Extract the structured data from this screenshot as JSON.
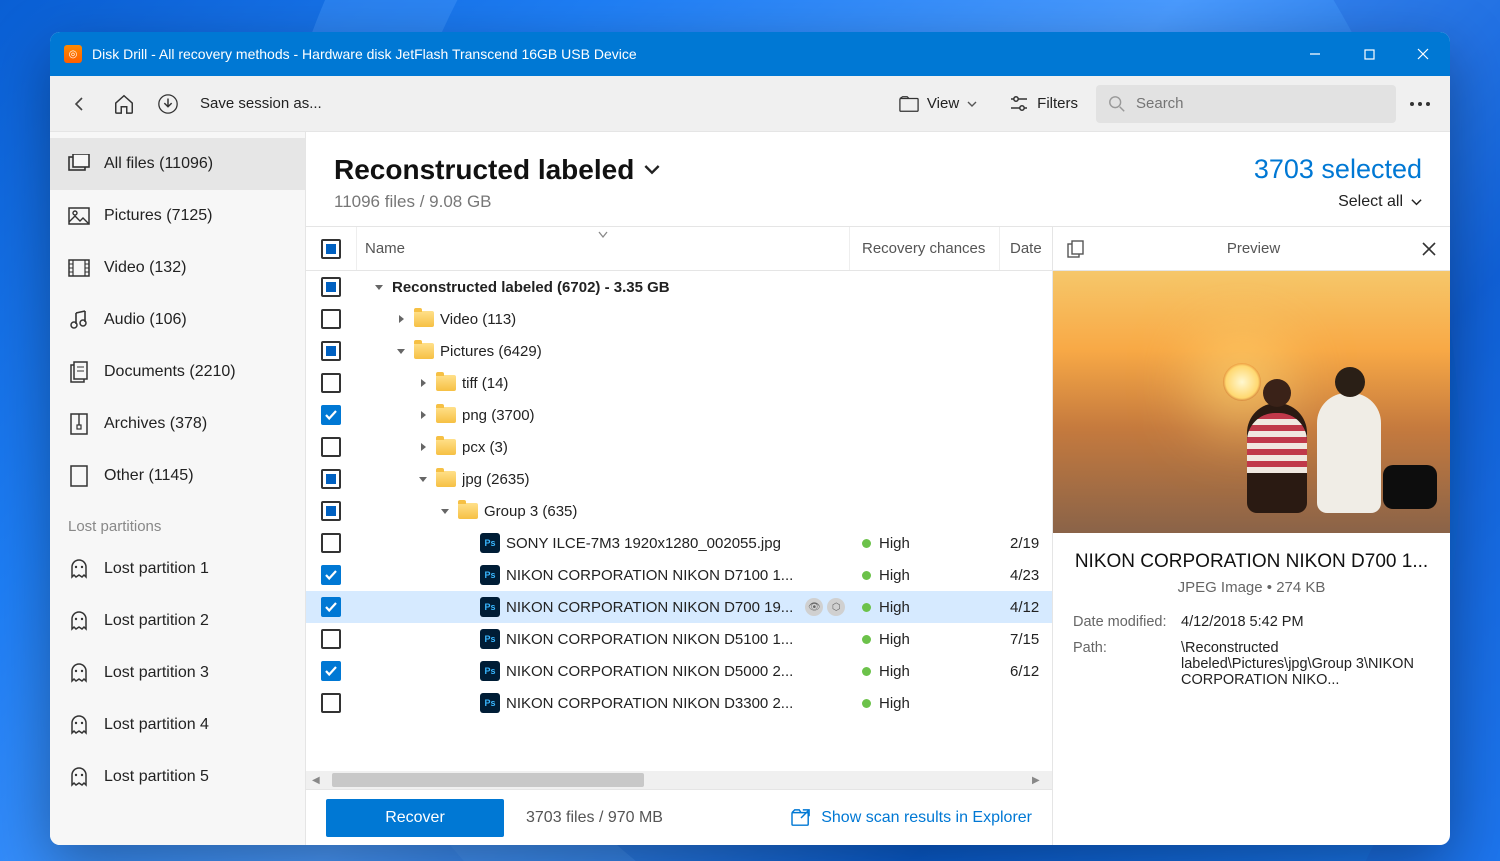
{
  "window": {
    "title": "Disk Drill - All recovery methods - Hardware disk JetFlash Transcend 16GB USB Device"
  },
  "toolbar": {
    "save_session": "Save session as...",
    "view_label": "View",
    "filters_label": "Filters",
    "search_placeholder": "Search"
  },
  "sidebar": {
    "items": [
      {
        "label": "All files (11096)"
      },
      {
        "label": "Pictures (7125)"
      },
      {
        "label": "Video (132)"
      },
      {
        "label": "Audio (106)"
      },
      {
        "label": "Documents (2210)"
      },
      {
        "label": "Archives (378)"
      },
      {
        "label": "Other (1145)"
      }
    ],
    "lost_header": "Lost partitions",
    "lost": [
      {
        "label": "Lost partition 1"
      },
      {
        "label": "Lost partition 2"
      },
      {
        "label": "Lost partition 3"
      },
      {
        "label": "Lost partition 4"
      },
      {
        "label": "Lost partition 5"
      }
    ]
  },
  "main": {
    "title": "Reconstructed labeled",
    "subtitle": "11096 files / 9.08 GB",
    "selected": "3703 selected",
    "select_all": "Select all"
  },
  "columns": {
    "name": "Name",
    "recovery": "Recovery chances",
    "date": "Date"
  },
  "rows": [
    {
      "chk": "square",
      "indent": 0,
      "expander": "down",
      "icon": "none",
      "name": "Reconstructed labeled (6702) - 3.35 GB",
      "bold": true
    },
    {
      "chk": "empty",
      "indent": 1,
      "expander": "right",
      "icon": "folder",
      "name": "Video (113)"
    },
    {
      "chk": "square",
      "indent": 1,
      "expander": "down",
      "icon": "folder",
      "name": "Pictures (6429)"
    },
    {
      "chk": "empty",
      "indent": 2,
      "expander": "right",
      "icon": "folder",
      "name": "tiff (14)"
    },
    {
      "chk": "check",
      "indent": 2,
      "expander": "right",
      "icon": "folder",
      "name": "png (3700)"
    },
    {
      "chk": "empty",
      "indent": 2,
      "expander": "right",
      "icon": "folder",
      "name": "pcx (3)"
    },
    {
      "chk": "square",
      "indent": 2,
      "expander": "down",
      "icon": "folder",
      "name": "jpg (2635)"
    },
    {
      "chk": "square",
      "indent": 3,
      "expander": "down",
      "icon": "folder",
      "name": "Group 3 (635)"
    },
    {
      "chk": "empty",
      "indent": 4,
      "expander": "",
      "icon": "ps",
      "name": "SONY ILCE-7M3 1920x1280_002055.jpg",
      "rec": "High",
      "date": "2/19"
    },
    {
      "chk": "check",
      "indent": 4,
      "expander": "",
      "icon": "ps",
      "name": "NIKON CORPORATION NIKON D7100 1...",
      "rec": "High",
      "date": "4/23"
    },
    {
      "chk": "check",
      "indent": 4,
      "expander": "",
      "icon": "ps",
      "name": "NIKON CORPORATION NIKON D700 19...",
      "rec": "High",
      "date": "4/12",
      "selected": true,
      "rowicons": true
    },
    {
      "chk": "empty",
      "indent": 4,
      "expander": "",
      "icon": "ps",
      "name": "NIKON CORPORATION NIKON D5100 1...",
      "rec": "High",
      "date": "7/15"
    },
    {
      "chk": "check",
      "indent": 4,
      "expander": "",
      "icon": "ps",
      "name": "NIKON CORPORATION NIKON D5000 2...",
      "rec": "High",
      "date": "6/12"
    },
    {
      "chk": "empty",
      "indent": 4,
      "expander": "",
      "icon": "ps",
      "name": "NIKON CORPORATION NIKON D3300 2...",
      "rec": "High",
      "date": ""
    }
  ],
  "footer": {
    "recover": "Recover",
    "stats": "3703 files / 970 MB",
    "explorer": "Show scan results in Explorer"
  },
  "preview": {
    "header": "Preview",
    "filename": "NIKON CORPORATION NIKON D700 1...",
    "fileinfo": "JPEG Image • 274 KB",
    "date_label": "Date modified:",
    "date_value": "4/12/2018 5:42 PM",
    "path_label": "Path:",
    "path_value": "\\Reconstructed labeled\\Pictures\\jpg\\Group 3\\NIKON CORPORATION NIKO..."
  }
}
